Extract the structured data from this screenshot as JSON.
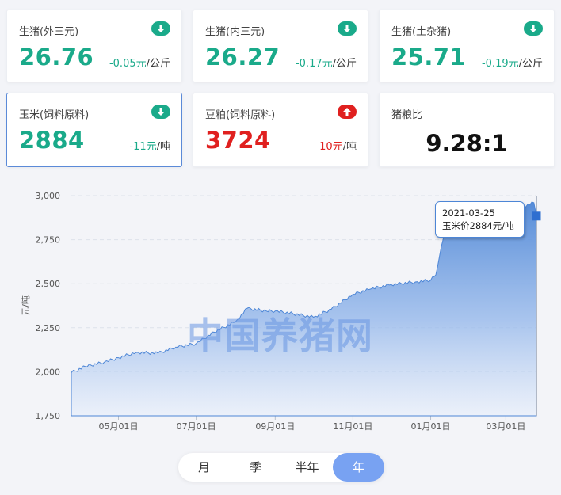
{
  "colors": {
    "down": "#1aaa8a",
    "up": "#e0201f",
    "accent": "#4d86d6"
  },
  "cards": [
    {
      "name": "card-pig-external",
      "title": "生猪(外三元)",
      "price": "26.76",
      "change": "-0.05元",
      "unit": "/公斤",
      "trend": "down",
      "icon": "arrow-down-icon"
    },
    {
      "name": "card-pig-internal",
      "title": "生猪(内三元)",
      "price": "26.27",
      "change": "-0.17元",
      "unit": "/公斤",
      "trend": "down",
      "icon": "arrow-down-icon"
    },
    {
      "name": "card-pig-local",
      "title": "生猪(土杂猪)",
      "price": "25.71",
      "change": "-0.19元",
      "unit": "/公斤",
      "trend": "down",
      "icon": "arrow-down-icon"
    },
    {
      "name": "card-corn",
      "title": "玉米(饲料原料)",
      "price": "2884",
      "change": "-11元",
      "unit": "/吨",
      "trend": "down",
      "icon": "arrow-down-icon",
      "selected": true
    },
    {
      "name": "card-soymeal",
      "title": "豆粕(饲料原料)",
      "price": "3724",
      "change": "10元",
      "unit": "/吨",
      "trend": "up",
      "icon": "arrow-up-icon"
    },
    {
      "name": "card-ratio",
      "title": "猪粮比",
      "ratio": "9.28:1"
    }
  ],
  "chart_data": {
    "type": "area",
    "series": [
      {
        "x": [
          "2020-03-25",
          "2020-04-05",
          "2020-04-20",
          "2020-05-01",
          "2020-05-15",
          "2020-06-01",
          "2020-06-15",
          "2020-07-01",
          "2020-07-15",
          "2020-08-01",
          "2020-08-10",
          "2020-08-25",
          "2020-09-01",
          "2020-09-15",
          "2020-10-01",
          "2020-10-15",
          "2020-11-01",
          "2020-11-15",
          "2020-12-01",
          "2020-12-20",
          "2021-01-01",
          "2021-01-05",
          "2021-01-08",
          "2021-01-12",
          "2021-01-20",
          "2021-02-01",
          "2021-02-15",
          "2021-03-01",
          "2021-03-15",
          "2021-03-23",
          "2021-03-25"
        ],
        "y": [
          1995,
          2030,
          2055,
          2080,
          2110,
          2105,
          2140,
          2160,
          2225,
          2285,
          2360,
          2345,
          2345,
          2330,
          2310,
          2355,
          2440,
          2470,
          2495,
          2510,
          2520,
          2550,
          2660,
          2800,
          2880,
          2885,
          2905,
          2925,
          2940,
          2960,
          2884
        ]
      }
    ],
    "x_ticks": [
      "05月01日",
      "07月01日",
      "09月01日",
      "11月01日",
      "01月01日",
      "03月01日"
    ],
    "x_tick_dates": [
      "2020-05-01",
      "2020-07-01",
      "2020-09-01",
      "2020-11-01",
      "2021-01-01",
      "2021-03-01"
    ],
    "x_range": [
      "2020-03-25",
      "2021-03-25"
    ],
    "y_ticks": [
      "1,750",
      "2,000",
      "2,250",
      "2,500",
      "2,750",
      "3,000"
    ],
    "y_tick_values": [
      1750,
      2000,
      2250,
      2500,
      2750,
      3000
    ],
    "ylim": [
      1750,
      3000
    ],
    "ylabel": "元/吨",
    "grid": true,
    "watermark": "中国养猪网",
    "tooltip": {
      "date": "2021-03-25",
      "label": "玉米价",
      "value": "2884",
      "unit": "元/吨"
    }
  },
  "range_selector": {
    "options": [
      "月",
      "季",
      "半年",
      "年"
    ],
    "selected": "年"
  }
}
